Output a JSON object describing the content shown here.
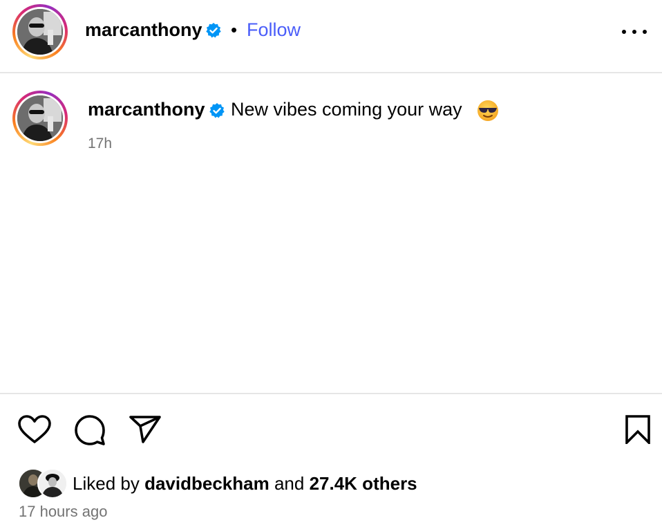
{
  "header": {
    "username": "marcanthony",
    "separator": "•",
    "follow_label": "Follow",
    "verified_icon": "verified-badge-icon",
    "more_icon": "more-options-icon"
  },
  "caption": {
    "username": "marcanthony",
    "text": "New vibes coming your way",
    "emoji": "smiling-face-with-sunglasses-icon",
    "time_short": "17h"
  },
  "actions": {
    "like_icon": "heart-icon",
    "comment_icon": "comment-icon",
    "share_icon": "send-icon",
    "save_icon": "bookmark-icon"
  },
  "likes": {
    "prefix": "Liked by",
    "user": "davidbeckham",
    "conjunction": "and",
    "others": "27.4K others"
  },
  "timestamp": "17 hours ago",
  "colors": {
    "follow_blue": "#4a5df9",
    "verified_blue": "#0095f6",
    "secondary_text": "#737373",
    "divider": "#e6e6e6"
  }
}
